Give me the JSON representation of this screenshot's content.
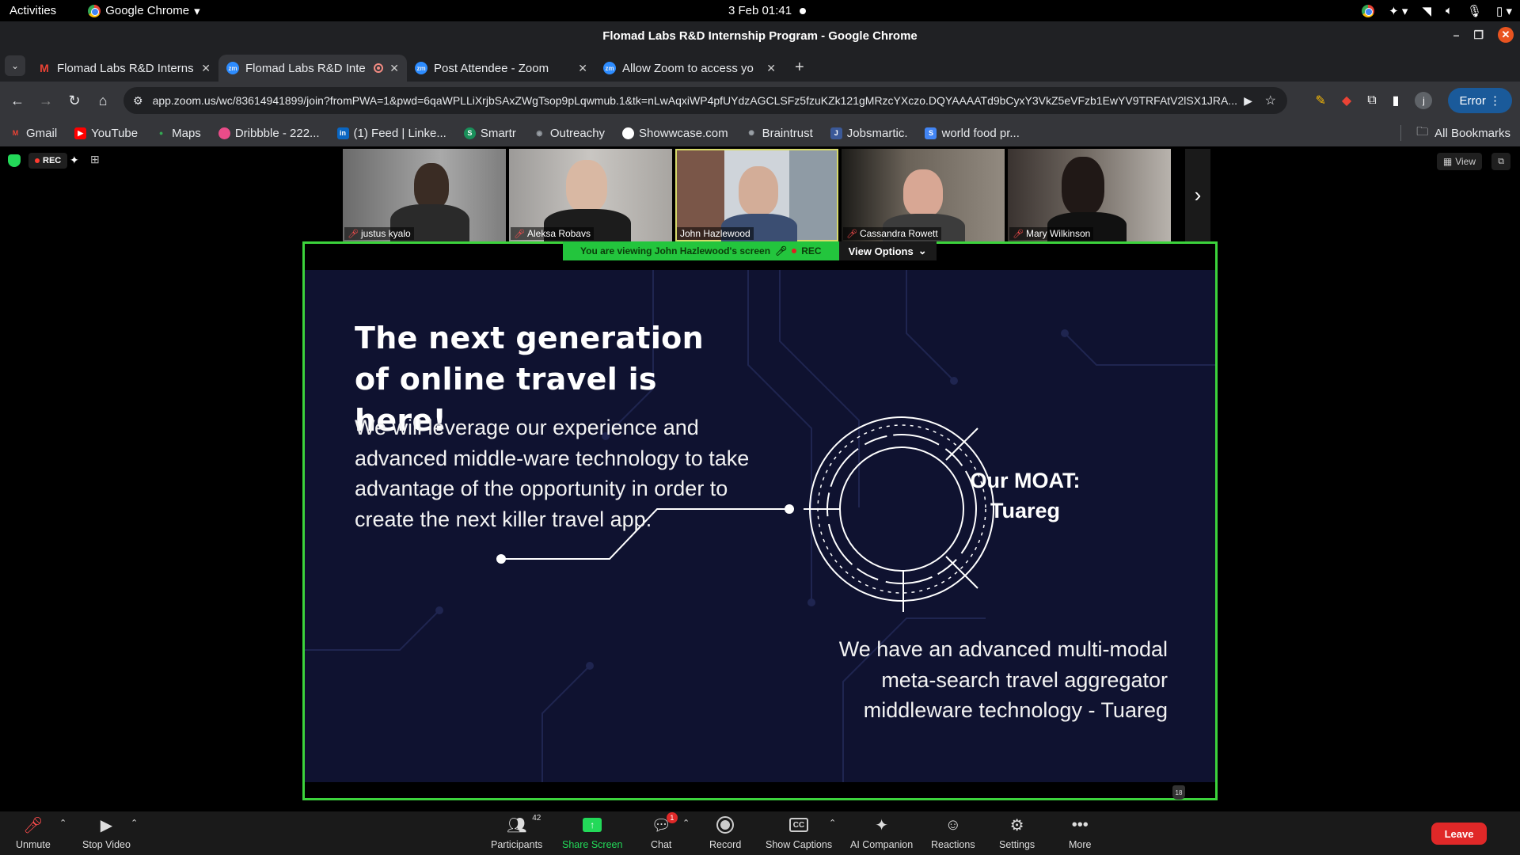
{
  "system": {
    "activities": "Activities",
    "app_name": "Google Chrome",
    "clock": "3 Feb  01:41"
  },
  "window": {
    "title": "Flomad Labs R&D Internship Program - Google Chrome"
  },
  "tabs": [
    {
      "label": "Flomad Labs R&D Interns",
      "icon": "gmail-icon"
    },
    {
      "label": "Flomad Labs R&D Inte",
      "icon": "zoom-icon",
      "active": true,
      "recording": true
    },
    {
      "label": "Post Attendee - Zoom",
      "icon": "zoom-icon"
    },
    {
      "label": "Allow Zoom to access yo",
      "icon": "zoom-icon"
    }
  ],
  "address_bar": {
    "url": "app.zoom.us/wc/83614941899/join?fromPWA=1&pwd=6qaWPLLiXrjbSAxZWgTsop9pLqwmub.1&tk=nLwAqxiWP4pfUYdzAGCLSFz5fzuKZk121gMRzcYXczo.DQYAAAATd9bCyxY3VkZ5eVFzb1EwYV9TRFAtV2lSX1JRA...",
    "error_label": "Error",
    "profile_initial": "j"
  },
  "bookmarks": [
    {
      "label": "Gmail",
      "icon": "gmail-icon",
      "color": "#ea4335"
    },
    {
      "label": "YouTube",
      "icon": "youtube-icon",
      "color": "#ff0000"
    },
    {
      "label": "Maps",
      "icon": "maps-icon",
      "color": "#34a853"
    },
    {
      "label": "Dribbble - 222...",
      "icon": "dribbble-icon",
      "color": "#ea4c89"
    },
    {
      "label": "(1) Feed | Linke...",
      "icon": "linkedin-icon",
      "color": "#0a66c2"
    },
    {
      "label": "Smartr",
      "icon": "smartr-icon",
      "color": "#1a8f5a"
    },
    {
      "label": "Outreachy",
      "icon": "outreachy-icon",
      "color": "#9aa0a6"
    },
    {
      "label": "Showwcase.com",
      "icon": "showwcase-icon",
      "color": "#ffffff"
    },
    {
      "label": "Braintrust",
      "icon": "braintrust-icon",
      "color": "#9aa0a6"
    },
    {
      "label": "Jobsmartic.",
      "icon": "jobsmartic-icon",
      "color": "#3b5998"
    },
    {
      "label": "world food pr...",
      "icon": "wfp-icon",
      "color": "#4285f4"
    }
  ],
  "all_bookmarks_label": "All Bookmarks",
  "zoom": {
    "rec_label": "REC",
    "view_label": "View",
    "participants_strip": [
      {
        "name": "justus kyalo",
        "muted": true
      },
      {
        "name": "Aleksa Robavs",
        "muted": true
      },
      {
        "name": "John Hazlewood",
        "muted": false,
        "active": true
      },
      {
        "name": "Cassandra Rowett",
        "muted": true
      },
      {
        "name": "Mary Wilkinson",
        "muted": true
      }
    ],
    "share_banner": {
      "text": "You are viewing  John Hazlewood's screen",
      "rec": "REC",
      "options": "View Options"
    },
    "slide": {
      "title": "The next generation of online travel is here!",
      "paragraph": "We will leverage our experience and advanced middle-ware technology to take advantage of the opportunity in order to create the next killer travel app.",
      "moat_line1": "Our MOAT:",
      "moat_line2": "Tuareg",
      "right_paragraph": "We have an advanced multi-modal meta-search travel aggregator middleware technology - Tuareg",
      "page_number": "18"
    },
    "toolbar": {
      "unmute": "Unmute",
      "stop_video": "Stop Video",
      "participants": "Participants",
      "participants_count": "42",
      "share_screen": "Share Screen",
      "chat": "Chat",
      "chat_badge": "1",
      "record": "Record",
      "show_captions": "Show Captions",
      "cc": "CC",
      "ai_companion": "AI Companion",
      "reactions": "Reactions",
      "settings": "Settings",
      "more": "More",
      "leave": "Leave"
    }
  },
  "colors": {
    "share_border": "#3cd33c",
    "slide_bg": "#0f1230",
    "leave_red": "#e02828",
    "share_green": "#23d959"
  }
}
